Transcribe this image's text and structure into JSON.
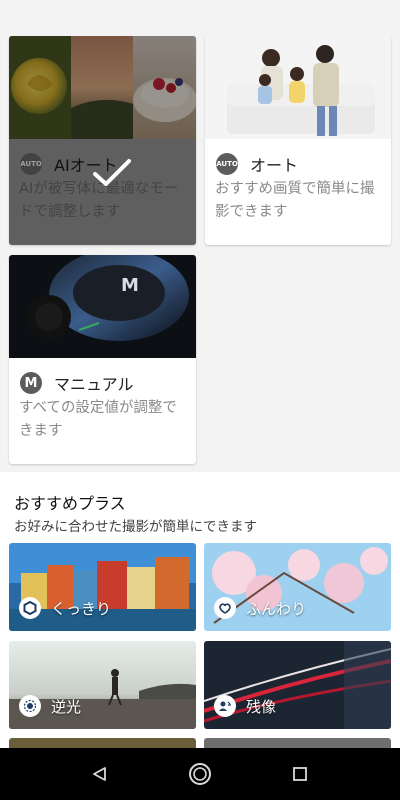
{
  "modes": [
    {
      "title": "AIオート",
      "icon_text": "AUTO",
      "description": "AIが被写体に最適なモードで調整します",
      "selected": true
    },
    {
      "title": "オート",
      "icon_text": "AUTO",
      "description": "おすすめ画質で簡単に撮影できます",
      "selected": false
    },
    {
      "title": "マニュアル",
      "icon_text": "M",
      "description": "すべての設定値が調整できます",
      "selected": false
    }
  ],
  "plus": {
    "title": "おすすめプラス",
    "subtitle": "お好みに合わせた撮影が簡単にできます",
    "tiles": [
      {
        "label": "くっきり",
        "icon": "sharp-icon"
      },
      {
        "label": "ふんわり",
        "icon": "soft-icon"
      },
      {
        "label": "逆光",
        "icon": "backlight-icon"
      },
      {
        "label": "残像",
        "icon": "afterimage-icon"
      }
    ]
  },
  "colors": {
    "accent": "#1f3d63",
    "selected_bg": "#9a9a9a"
  }
}
